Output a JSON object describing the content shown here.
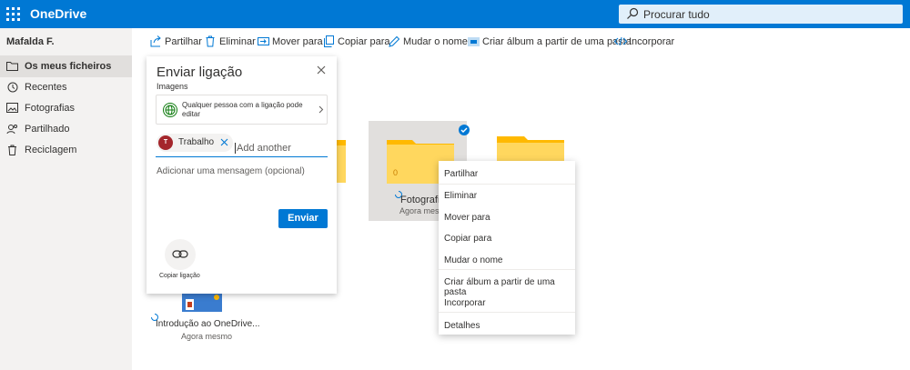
{
  "app": {
    "brand": "OneDrive"
  },
  "search": {
    "placeholder": "Procurar tudo"
  },
  "sidebar": {
    "user": "Mafalda F.",
    "items": [
      {
        "label": "Os meus ficheiros",
        "icon": "folder-icon",
        "active": true
      },
      {
        "label": "Recentes",
        "icon": "history-icon"
      },
      {
        "label": "Fotografias",
        "icon": "image-icon"
      },
      {
        "label": "Partilhado",
        "icon": "people-icon"
      },
      {
        "label": "Reciclagem",
        "icon": "trash-icon"
      }
    ]
  },
  "toolbar": {
    "share": "Partilhar",
    "delete": "Eliminar",
    "move": "Mover para",
    "copy": "Copiar para",
    "rename": "Mudar o nome",
    "album": "Criar álbum a partir de uma pasta",
    "embed": "Incorporar"
  },
  "dialog": {
    "title": "Enviar ligação",
    "subtitle": "Imagens",
    "permission": "Qualquer pessoa com a ligação pode editar",
    "recipient_initial": "T",
    "recipient": "Trabalho",
    "add_placeholder": "Add another",
    "message_placeholder": "Adicionar uma mensagem (opcional)",
    "send": "Enviar",
    "copy_link": "Copiar ligação"
  },
  "files": [
    {
      "name": "Fotografias",
      "modified": "Agora mesmo",
      "count": "0",
      "selected": true
    },
    {
      "name": "Introdução ao OneDrive...",
      "modified": "Agora mesmo"
    }
  ],
  "context_menu": [
    "Partilhar",
    "Eliminar",
    "Mover para",
    "Copiar para",
    "Mudar o nome",
    "Criar álbum a partir de uma pasta",
    "Incorporar",
    "Detalhes"
  ],
  "colors": {
    "brand": "#0078d4",
    "folder": "#ffb900"
  }
}
